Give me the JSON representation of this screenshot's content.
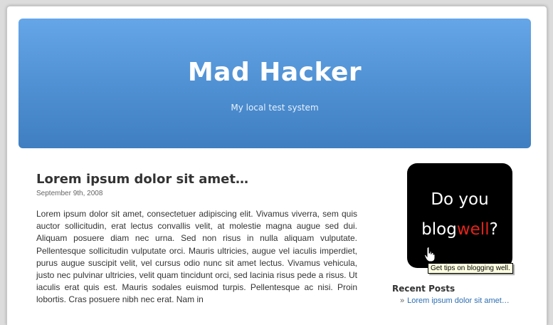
{
  "header": {
    "title": "Mad Hacker",
    "tagline": "My local test system"
  },
  "post": {
    "title": "Lorem ipsum dolor sit amet…",
    "date": "September 9th, 2008",
    "body": "Lorem ipsum dolor sit amet, consectetuer adipiscing elit. Vivamus viverra, sem quis auctor sollicitudin, erat lectus convallis velit, at molestie magna augue sed dui. Aliquam posuere diam nec urna. Sed non risus in nulla aliquam vulputate. Pellentesque sollicitudin vulputate orci. Mauris ultricies, augue vel iaculis imperdiet, purus augue suscipit velit, vel cursus odio nunc sit amet lectus. Vivamus vehicula, justo nec pulvinar ultricies, velit quam tincidunt orci, sed lacinia risus pede a risus. Ut iaculis erat quis est. Mauris sodales euismod turpis. Pellentesque ac nisi. Proin lobortis. Cras posuere nibh nec erat. Nam in"
  },
  "sidebar": {
    "ad": {
      "line1": "Do you",
      "line2_blog": "blog",
      "line2_well": "well",
      "line2_end": "?",
      "tooltip": "Get tips on blogging well."
    },
    "recent_posts": {
      "heading": "Recent Posts",
      "items": [
        {
          "bullet": "»",
          "label": "Lorem ipsum dolor sit amet…"
        }
      ]
    }
  },
  "colors": {
    "header_top": "#65a6e8",
    "header_bottom": "#3f7fc1",
    "link": "#2d6fb3",
    "ad_accent": "#e2231a"
  }
}
